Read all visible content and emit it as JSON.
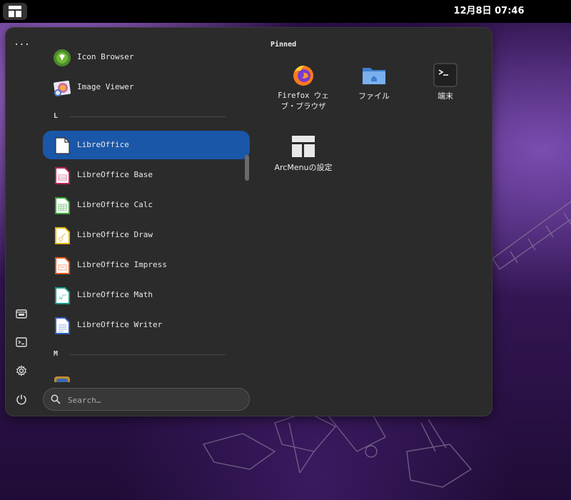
{
  "topbar": {
    "clock": "12月8日 07:46",
    "apps_icon": "layout-grid-icon"
  },
  "sidebar": {
    "items": [
      {
        "name": "more-icon",
        "glyph": "···"
      },
      {
        "name": "files-icon"
      },
      {
        "name": "terminal-icon"
      },
      {
        "name": "settings-icon"
      },
      {
        "name": "power-icon"
      }
    ]
  },
  "applist": {
    "sections": [
      "L",
      "M"
    ],
    "items": [
      {
        "label": "Icon Browser",
        "icon": "icon-browser-icon"
      },
      {
        "label": "Image Viewer",
        "icon": "image-viewer-icon"
      },
      {
        "label": "LibreOffice",
        "icon": "libreoffice-icon",
        "selected": true
      },
      {
        "label": "LibreOffice Base",
        "icon": "libreoffice-base-icon"
      },
      {
        "label": "LibreOffice Calc",
        "icon": "libreoffice-calc-icon"
      },
      {
        "label": "LibreOffice Draw",
        "icon": "libreoffice-draw-icon"
      },
      {
        "label": "LibreOffice Impress",
        "icon": "libreoffice-impress-icon"
      },
      {
        "label": "LibreOffice Math",
        "icon": "libreoffice-math-icon"
      },
      {
        "label": "LibreOffice Writer",
        "icon": "libreoffice-writer-icon"
      }
    ]
  },
  "search": {
    "placeholder": "Search…"
  },
  "pinned": {
    "title": "Pinned",
    "items": [
      {
        "label_line1": "Firefox ウェ",
        "label_line2": "ブ・ブラウザ",
        "icon": "firefox-icon"
      },
      {
        "label_line1": "ファイル",
        "icon": "files-folder-icon"
      },
      {
        "label_line1": "端末",
        "icon": "terminal-icon"
      },
      {
        "label_line1": "ArcMenuの設定",
        "icon": "arcmenu-settings-icon"
      }
    ]
  },
  "colors": {
    "selected": "#1a57a8",
    "menu_bg": "#2b2b2b",
    "calc": "#3aa33a",
    "base": "#c0245c",
    "draw": "#e6b800",
    "impress": "#e0581c",
    "math": "#1a9c8c",
    "writer": "#2f5ec0"
  }
}
